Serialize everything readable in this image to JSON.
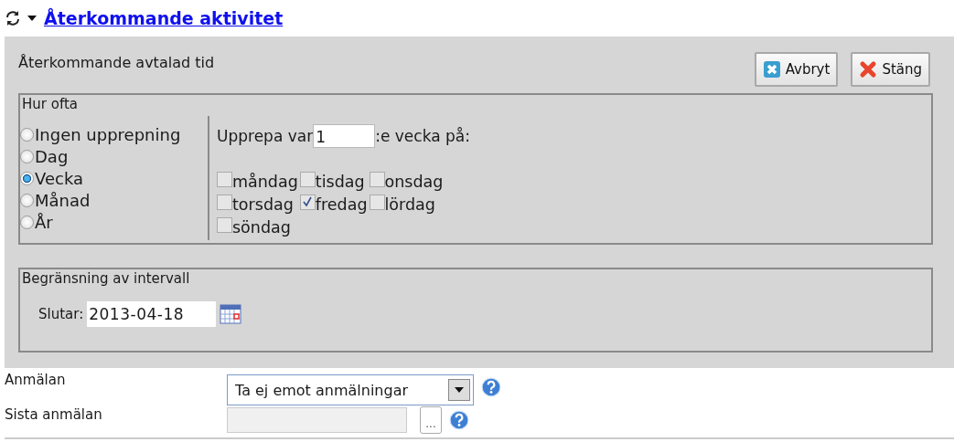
{
  "header": {
    "title": "Återkommande aktivitet",
    "expanded": true
  },
  "panel": {
    "title": "Återkommande avtalad tid",
    "buttons": [
      {
        "label": "Avbryt",
        "kind": "cancel"
      },
      {
        "label": "Stäng",
        "kind": "close"
      }
    ],
    "frequency": {
      "legend": "Hur ofta",
      "options": [
        {
          "label": "Ingen upprepning",
          "selected": false
        },
        {
          "label": "Dag",
          "selected": false
        },
        {
          "label": "Vecka",
          "selected": true
        },
        {
          "label": "Månad",
          "selected": false
        },
        {
          "label": "År",
          "selected": false
        }
      ],
      "repeat_before": "Upprepa var",
      "repeat_value": "1",
      "repeat_after": ":e vecka på:",
      "days": [
        {
          "label": "måndag",
          "checked": false
        },
        {
          "label": "tisdag",
          "checked": false
        },
        {
          "label": "onsdag",
          "checked": false
        },
        {
          "label": "torsdag",
          "checked": false
        },
        {
          "label": "fredag",
          "checked": true
        },
        {
          "label": "lördag",
          "checked": false
        },
        {
          "label": "söndag",
          "checked": false
        }
      ]
    },
    "limit": {
      "legend": "Begränsning av intervall",
      "end_label": "Slutar:",
      "end_date": "2013-04-18"
    }
  },
  "fields": [
    {
      "label": "Anmälan",
      "kind": "select",
      "value": "Ta ej emot anmälningar"
    },
    {
      "label": "Sista anmälan",
      "kind": "picker",
      "disabled": true,
      "button": "..."
    }
  ]
}
